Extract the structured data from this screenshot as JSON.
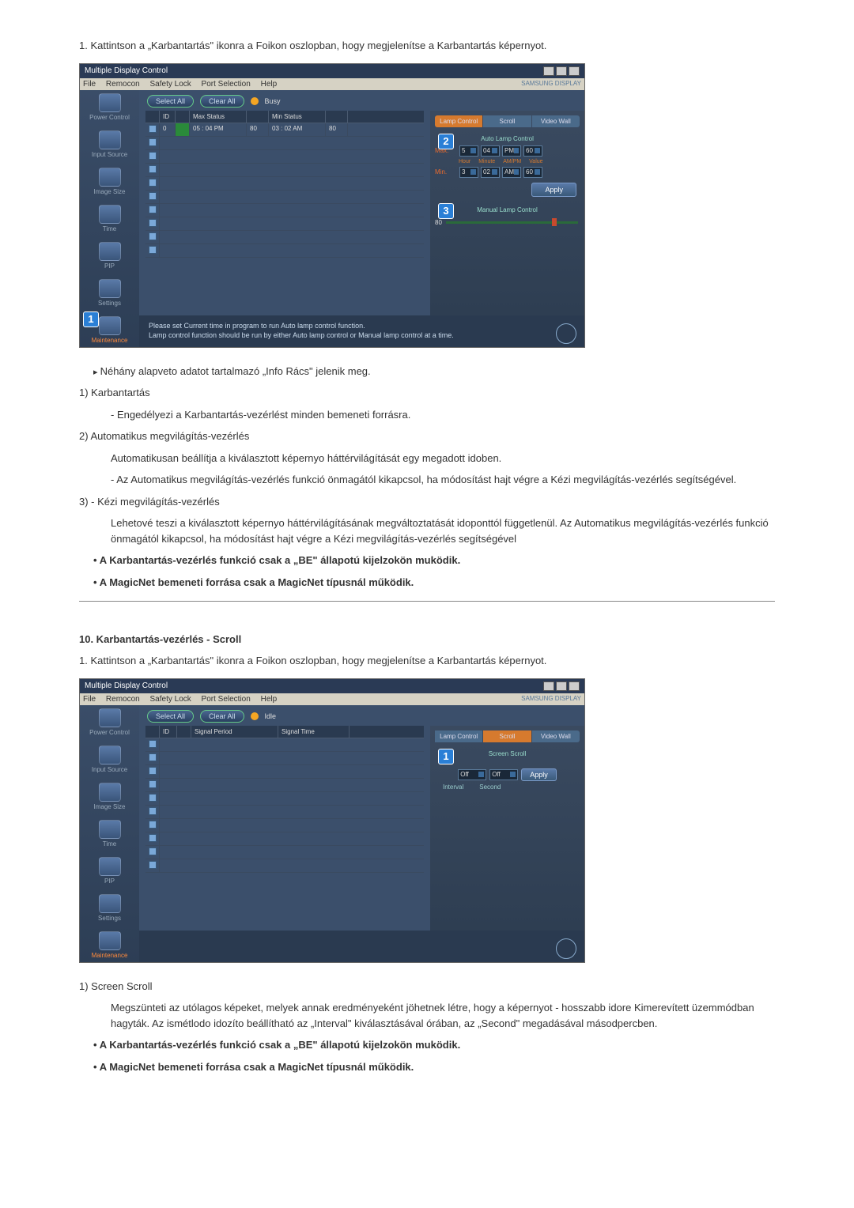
{
  "step1": "1.  Kattintson a „Karbantartás\" ikonra a Foikon oszlopban, hogy megjelenítse a Karbantartás képernyot.",
  "app1": {
    "title": "Multiple Display Control",
    "menu": [
      "File",
      "Remocon",
      "Safety Lock",
      "Port Selection",
      "Help"
    ],
    "brand": "SAMSUNG DISPLAY",
    "sidebar": [
      "Power Control",
      "Input Source",
      "Image Size",
      "Time",
      "PIP",
      "Settings",
      "Maintenance"
    ],
    "select_all": "Select All",
    "clear_all": "Clear All",
    "status": "Busy",
    "table_headers": [
      "",
      "ID",
      "",
      "Max Status",
      "",
      "Min Status",
      ""
    ],
    "row1": [
      "",
      "0",
      "",
      "05 : 04  PM",
      "80",
      "03 : 02  AM",
      "80"
    ],
    "tabs": [
      "Lamp Control",
      "Scroll",
      "Video Wall"
    ],
    "auto_lamp": "Auto Lamp Control",
    "max_label": "Max.",
    "min_label": "Min.",
    "max_vals": [
      "5",
      "04",
      "PM",
      "60"
    ],
    "min_vals": [
      "3",
      "02",
      "AM",
      "60"
    ],
    "sublabels": [
      "Hour",
      "Minute",
      "AM/PM",
      "Value"
    ],
    "apply": "Apply",
    "manual_lamp": "Manual Lamp Control",
    "slider_val": "80",
    "footer1": "Please set Current time in program to run Auto lamp control function.",
    "footer2": "Lamp control function should be run by either Auto lamp control or Manual lamp control at a time."
  },
  "body1": {
    "arrow": "Néhány alapveto adatot tartalmazó „Info Rács\" jelenik meg.",
    "i1_h": "1)  Karbantartás",
    "i1_t": "- Engedélyezi a Karbantartás-vezérlést minden bemeneti forrásra.",
    "i2_h": "2)  Automatikus megvilágítás-vezérlés",
    "i2_t1": "Automatikusan beállítja a kiválasztott képernyo háttérvilágítását egy megadott idoben.",
    "i2_t2": "- Az Automatikus megvilágítás-vezérlés funkció önmagától kikapcsol, ha módosítást hajt végre a Kézi megvilágítás-vezérlés segítségével.",
    "i3_h": "3)  - Kézi megvilágítás-vezérlés",
    "i3_t": "Lehetové teszi a kiválasztott képernyo háttérvilágításának megváltoztatását idoponttól függetlenül. Az Automatikus megvilágítás-vezérlés funkció önmagától kikapcsol, ha módosítást hajt végre a Kézi megvilágítás-vezérlés segítségével",
    "b1": "A Karbantartás-vezérlés funkció csak a „BE\" állapotú kijelzokön muködik.",
    "b2": "A MagicNet bemeneti forrása csak a MagicNet típusnál működik."
  },
  "heading2": "10. Karbantartás-vezérlés - Scroll",
  "step2": "1.  Kattintson a „Karbantartás\" ikonra a Foikon oszlopban, hogy megjelenítse a Karbantartás képernyot.",
  "app2": {
    "title": "Multiple Display Control",
    "menu": [
      "File",
      "Remocon",
      "Safety Lock",
      "Port Selection",
      "Help"
    ],
    "brand": "SAMSUNG DISPLAY",
    "sidebar": [
      "Power Control",
      "Input Source",
      "Image Size",
      "Time",
      "PIP",
      "Settings",
      "Maintenance"
    ],
    "select_all": "Select All",
    "clear_all": "Clear All",
    "status": "Idle",
    "table_headers": [
      "",
      "ID",
      "",
      "Signal Period",
      "Signal Time"
    ],
    "tabs": [
      "Lamp Control",
      "Scroll",
      "Video Wall"
    ],
    "screen_scroll": "Screen Scroll",
    "interval": "Interval",
    "second": "Second",
    "sel1": "Off",
    "sel2": "Off",
    "apply": "Apply"
  },
  "body2": {
    "i1_h": "1)  Screen Scroll",
    "i1_t": "Megszünteti az utólagos képeket, melyek annak eredményeként jöhetnek létre, hogy a képernyot - hosszabb idore Kimerevített üzemmódban hagyták. Az ismétlodo idozíto beállítható az „Interval\" kiválasztásával órában, az „Second\" megadásával másodpercben.",
    "b1": "A Karbantartás-vezérlés funkció csak a „BE\" állapotú kijelzokön muködik.",
    "b2": "A MagicNet bemeneti forrása csak a MagicNet típusnál működik."
  }
}
